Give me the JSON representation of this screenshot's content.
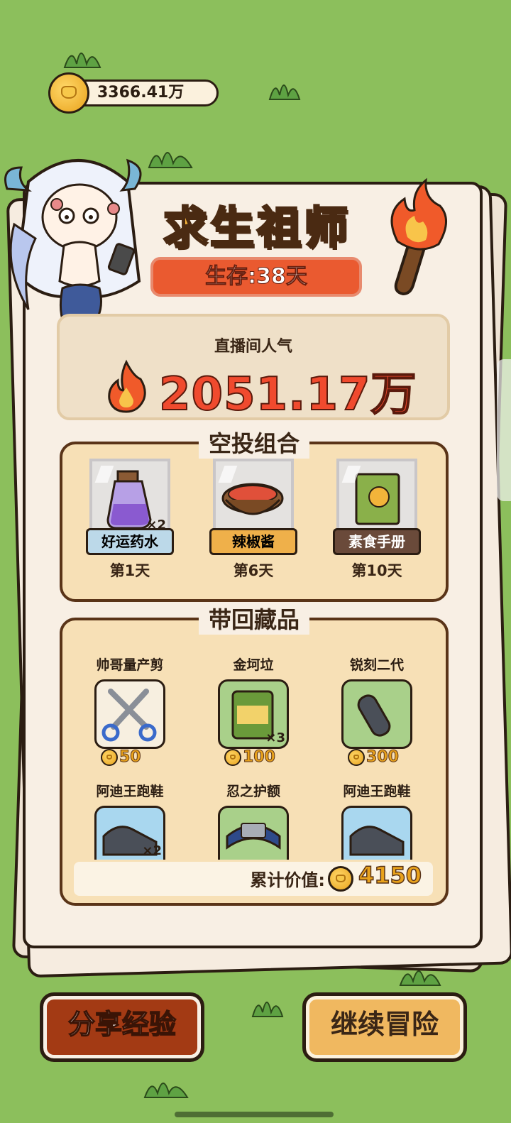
{
  "header": {
    "coins": "3366.41万"
  },
  "title": {
    "main": "求生祖师",
    "survival": "生存:38天"
  },
  "popularity": {
    "label": "直播间人气",
    "value": "2051.17万"
  },
  "airdrop": {
    "title": "空投组合",
    "items": [
      {
        "name": "好运药水",
        "day": "第1天",
        "multiplier": "×2",
        "tag_color": "#bcd9e9"
      },
      {
        "name": "辣椒酱",
        "day": "第6天",
        "multiplier": "",
        "tag_color": "#efb04a"
      },
      {
        "name": "素食手册",
        "day": "第10天",
        "multiplier": "",
        "tag_color": "#6a4a3a"
      }
    ]
  },
  "loot": {
    "title": "带回藏品",
    "items": [
      {
        "name": "帅哥量产剪",
        "price": "50",
        "multiplier": ""
      },
      {
        "name": "金坷垃",
        "price": "100",
        "multiplier": "×3"
      },
      {
        "name": "锐刻二代",
        "price": "300",
        "multiplier": ""
      },
      {
        "name": "阿迪王跑鞋",
        "price": "",
        "multiplier": "×2"
      },
      {
        "name": "忍之护额",
        "price": "",
        "multiplier": ""
      },
      {
        "name": "阿迪王跑鞋",
        "price": "",
        "multiplier": ""
      }
    ],
    "total_label": "累计价值:",
    "total_value": "4150"
  },
  "buttons": {
    "share": "分享经验",
    "continue": "继续冒险"
  },
  "colors": {
    "grass": "#8cbf5c",
    "paper": "#f8efe4",
    "accent": "#ea5a30",
    "gold": "#e9a21b"
  }
}
